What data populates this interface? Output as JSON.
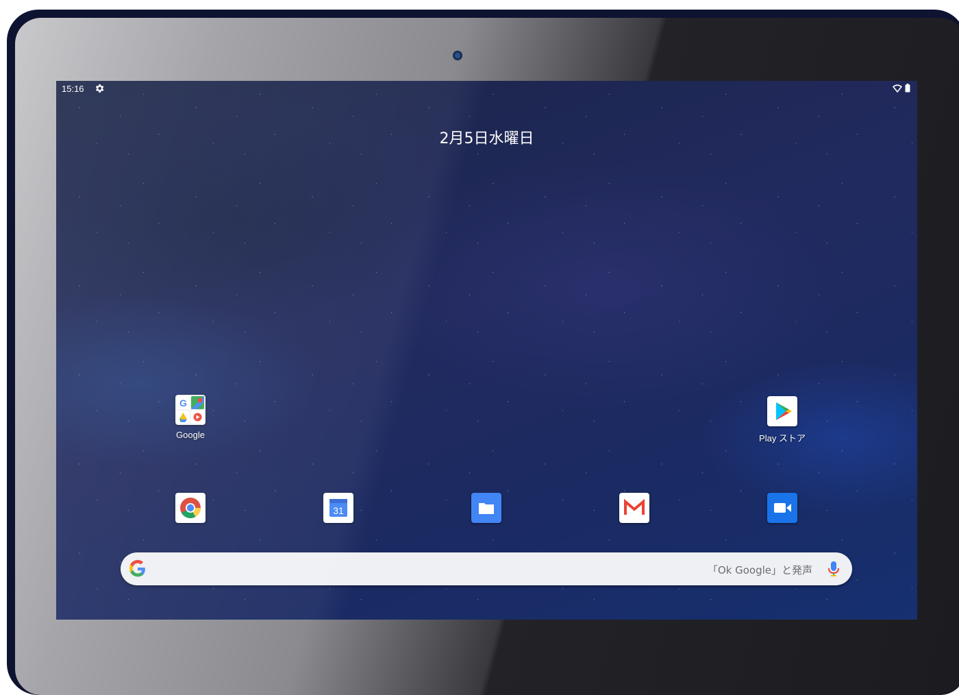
{
  "status_bar": {
    "time": "15:16",
    "settings_icon": "gear-icon",
    "wifi_icon": "wifi-icon",
    "battery_icon": "battery-icon"
  },
  "date": "2月5日水曜日",
  "home_apps": [
    {
      "label": "Google",
      "icon": "google-folder-icon"
    },
    {
      "label": "Play ストア",
      "icon": "play-store-icon"
    }
  ],
  "dock": [
    {
      "icon": "chrome-icon"
    },
    {
      "icon": "calendar-icon",
      "text": "31"
    },
    {
      "icon": "files-icon"
    },
    {
      "icon": "gmail-icon"
    },
    {
      "icon": "duo-icon"
    }
  ],
  "search": {
    "hint": "「Ok Google」と発声",
    "google_icon": "google-g-icon",
    "mic_icon": "mic-icon"
  },
  "colors": {
    "wallpaper_dark": "#1a2446",
    "wallpaper_blue": "#1b2a62",
    "search_bg": "#eef0f3",
    "google_blue": "#4285F4",
    "google_red": "#EA4335",
    "google_yellow": "#FBBC05",
    "google_green": "#34A853"
  }
}
